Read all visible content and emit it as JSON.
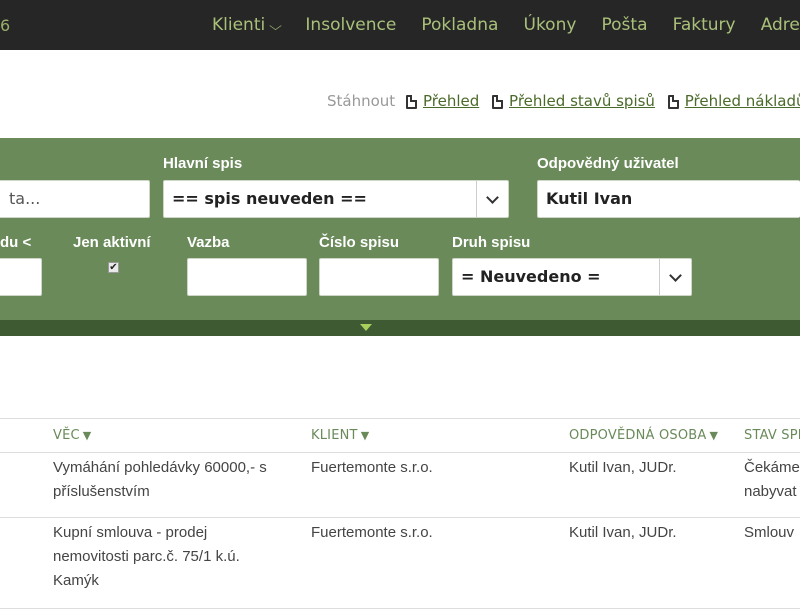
{
  "header": {
    "left_fragment": "6",
    "nav": [
      {
        "label": "Klienti"
      },
      {
        "label": "Insolvence"
      },
      {
        "label": "Pokladna"
      },
      {
        "label": "Úkony"
      },
      {
        "label": "Pošta"
      },
      {
        "label": "Faktury"
      },
      {
        "label": "Adresá"
      }
    ]
  },
  "download": {
    "label": "Stáhnout",
    "links": [
      "Přehled",
      "Přehled stavů spisů",
      "Přehled nákladů"
    ]
  },
  "filter": {
    "search_placeholder": "ta...",
    "hlavni_spis_label": "Hlavní spis",
    "hlavni_spis_value": "== spis neuveden ==",
    "uzivatel_label": "Odpovědný uživatel",
    "uzivatel_value": "Kutil Ivan",
    "partial_label": "du <",
    "jen_aktivni_label": "Jen aktivní",
    "jen_aktivni_checked": "✔",
    "vazba_label": "Vazba",
    "cislo_spisu_label": "Číslo spisu",
    "druh_spisu_label": "Druh spisu",
    "druh_spisu_value": "= Neuvedeno ="
  },
  "table": {
    "headers": [
      "VĚC",
      "KLIENT",
      "ODPOVĚDNÁ OSOBA",
      "STAV SPI"
    ],
    "sort_icon": "▼",
    "rows": [
      {
        "vec_1": "Vymáhání pohledávky 60000,- s",
        "vec_2": "příslušenstvím",
        "vec_3": "",
        "klient": "Fuertemonte s.r.o.",
        "osoba": "Kutil Ivan, JUDr.",
        "stav_1": "Čekáme",
        "stav_2": "nabyvat"
      },
      {
        "vec_1": "Kupní smlouva - prodej",
        "vec_2": "nemovitosti parc.č. 75/1 k.ú.",
        "vec_3": "Kamýk",
        "klient": "Fuertemonte s.r.o.",
        "osoba": "Kutil Ivan, JUDr.",
        "stav_1": "Smlouv",
        "stav_2": ""
      }
    ]
  },
  "colors": {
    "topbar": "#262626",
    "nav_text": "#a9c07a",
    "panel": "#6a8a5a",
    "panel_bottom": "#3d5a33",
    "header_text": "#6a8a5a"
  }
}
